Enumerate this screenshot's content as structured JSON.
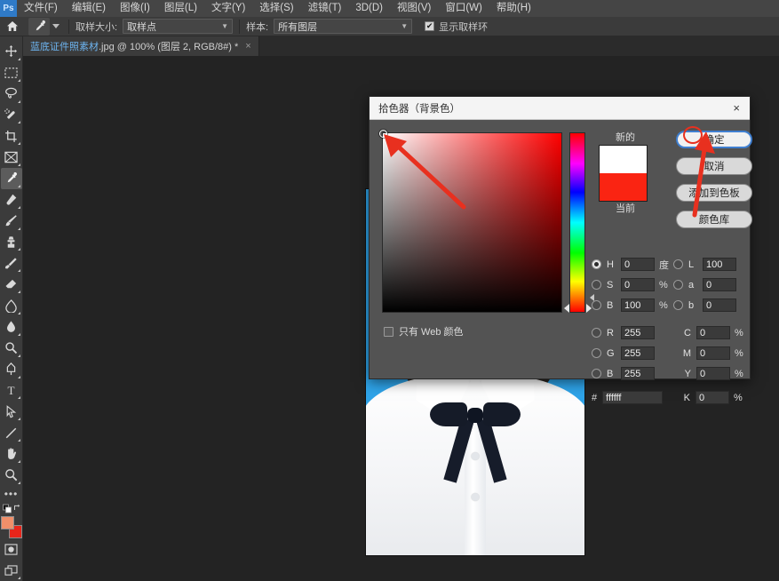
{
  "app": {
    "name": "Adobe Photoshop",
    "logo_text": "Ps"
  },
  "menubar": {
    "items": [
      {
        "label": "文件(F)"
      },
      {
        "label": "编辑(E)"
      },
      {
        "label": "图像(I)"
      },
      {
        "label": "图层(L)"
      },
      {
        "label": "文字(Y)"
      },
      {
        "label": "选择(S)"
      },
      {
        "label": "滤镜(T)"
      },
      {
        "label": "3D(D)"
      },
      {
        "label": "视图(V)"
      },
      {
        "label": "窗口(W)"
      },
      {
        "label": "帮助(H)"
      }
    ]
  },
  "optionsbar": {
    "home_icon": "home-icon",
    "tool_icon": "eyedropper-icon",
    "sample_size_label": "取样大小:",
    "sample_size_value": "取样点",
    "sample_label": "样本:",
    "sample_value": "所有图层",
    "show_ring_label": "显示取样环",
    "show_ring_checked": true
  },
  "tabbar": {
    "tab_title_main": "蓝底证件照素材",
    "tab_title_rest": ".jpg @ 100% (图层 2, RGB/8#) *",
    "close_glyph": "×"
  },
  "toolbar": {
    "tools": [
      {
        "name": "move-tool"
      },
      {
        "name": "rectangular-marquee-tool"
      },
      {
        "name": "lasso-tool"
      },
      {
        "name": "quick-selection-tool"
      },
      {
        "name": "crop-tool"
      },
      {
        "name": "frame-tool"
      },
      {
        "name": "eyedropper-tool",
        "active": true
      },
      {
        "name": "spot-healing-brush-tool"
      },
      {
        "name": "brush-tool"
      },
      {
        "name": "clone-stamp-tool"
      },
      {
        "name": "history-brush-tool"
      },
      {
        "name": "eraser-tool"
      },
      {
        "name": "gradient-tool"
      },
      {
        "name": "blur-tool"
      },
      {
        "name": "dodge-tool"
      },
      {
        "name": "pen-tool"
      },
      {
        "name": "horizontal-type-tool"
      },
      {
        "name": "path-selection-tool"
      },
      {
        "name": "line-tool"
      },
      {
        "name": "hand-tool"
      },
      {
        "name": "zoom-tool"
      },
      {
        "name": "edit-toolbar-tool"
      }
    ],
    "foreground_color": "#ef8f6a",
    "background_color": "#e8251a",
    "quickmask_name": "quick-mask-toggle",
    "screenmode_name": "screen-mode-toggle"
  },
  "canvas": {
    "photo": {
      "name": "id-photo-blue-background",
      "background_color": "#2ea3e8",
      "shirt_color": "#ffffff",
      "bowtie_color": "#151b28",
      "hair_color": "#2a2521",
      "skin_color": "#eec4ab"
    }
  },
  "picker": {
    "title": "拾色器（背景色）",
    "close_glyph": "×",
    "swatch": {
      "new_label": "新的",
      "current_label": "当前",
      "new_color": "#ffffff",
      "current_color": "#fa2412"
    },
    "buttons": [
      {
        "label": "确定",
        "name": "ok-button",
        "primary": true
      },
      {
        "label": "取消",
        "name": "cancel-button",
        "primary": false
      },
      {
        "label": "添加到色板",
        "name": "add-to-swatches-button",
        "primary": false
      },
      {
        "label": "颜色库",
        "name": "color-libraries-button",
        "primary": false
      }
    ],
    "web_only_label": "只有 Web 颜色",
    "web_only_checked": false,
    "hsb": [
      {
        "key": "H",
        "value": "0",
        "unit": "度",
        "selected": true
      },
      {
        "key": "S",
        "value": "0",
        "unit": "%",
        "selected": false
      },
      {
        "key": "B",
        "value": "100",
        "unit": "%",
        "selected": false
      }
    ],
    "rgb": [
      {
        "key": "R",
        "value": "255",
        "selected": false
      },
      {
        "key": "G",
        "value": "255",
        "selected": false
      },
      {
        "key": "B",
        "value": "255",
        "selected": false
      }
    ],
    "lab": [
      {
        "key": "L",
        "value": "100",
        "selected": false
      },
      {
        "key": "a",
        "value": "0",
        "selected": false
      },
      {
        "key": "b",
        "value": "0",
        "selected": false
      }
    ],
    "cmyk": [
      {
        "key": "C",
        "value": "0",
        "unit": "%"
      },
      {
        "key": "M",
        "value": "0",
        "unit": "%"
      },
      {
        "key": "Y",
        "value": "0",
        "unit": "%"
      },
      {
        "key": "K",
        "value": "0",
        "unit": "%"
      }
    ],
    "hex_prefix": "#",
    "hex_value": "ffffff"
  },
  "annotations": {
    "arrow_color": "#e8301f",
    "arrow_to_white_corner": "annotation-arrow-white-corner",
    "arrow_to_ok_button": "annotation-arrow-ok-button"
  }
}
